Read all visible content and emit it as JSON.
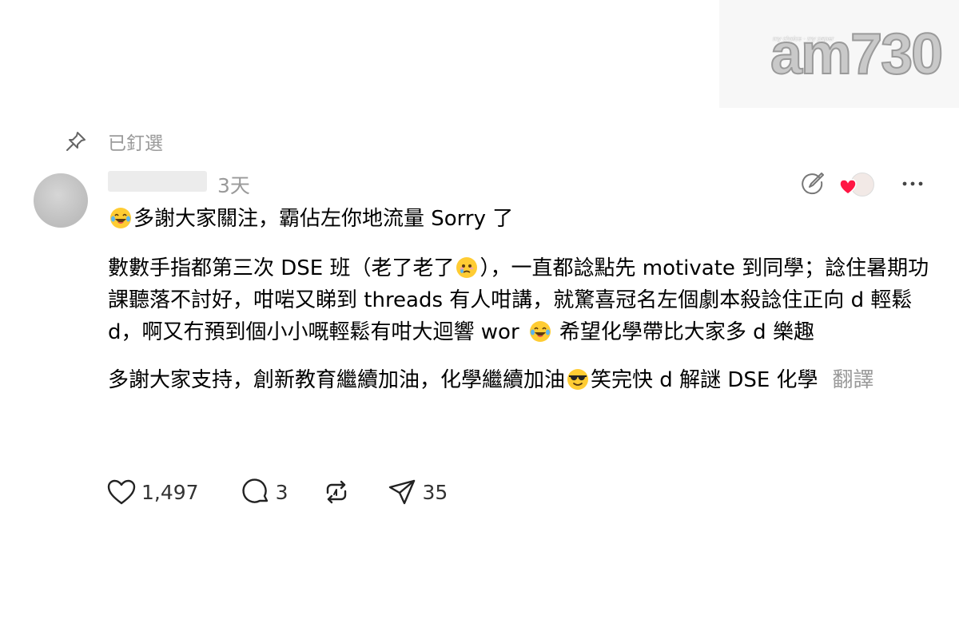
{
  "watermark": {
    "tagline": "my choice · my paper",
    "logo": "am730"
  },
  "pinned": {
    "label": "已釘選"
  },
  "post": {
    "timestamp": "3天",
    "line1": "多謝大家關注，霸佔左你地流量 Sorry 了",
    "p2_a": "數數手指都第三次 DSE 班（老了老了",
    "p2_b": "），一直都諗點先 motivate 到同學；諗住暑期功課聽落不討好，咁啱又睇到 threads 有人咁講，就驚喜冠名左個劇本殺諗住正向 d 輕鬆 d，啊又冇預到個小小嘅輕鬆有咁大迴響 wor",
    "p2_c": " 希望化學帶比大家多 d 樂趣",
    "p3_a": "多謝大家支持，創新教育繼續加油，化學繼續加油",
    "p3_b": "笑完快 d 解謎 DSE 化學",
    "translate": "翻譯"
  },
  "actions": {
    "likes": "1,497",
    "comments": "3",
    "shares": "35"
  },
  "colors": {
    "heart": "#ff1744",
    "muted": "#9a9a9a",
    "emoji": "#ffcc33"
  },
  "icons": [
    "pin-icon",
    "edit-icon",
    "heart-icon",
    "more-icon",
    "like-icon",
    "comment-icon",
    "repost-icon",
    "share-icon",
    "laughing-emoji",
    "teary-emoji",
    "sunglasses-emoji"
  ]
}
